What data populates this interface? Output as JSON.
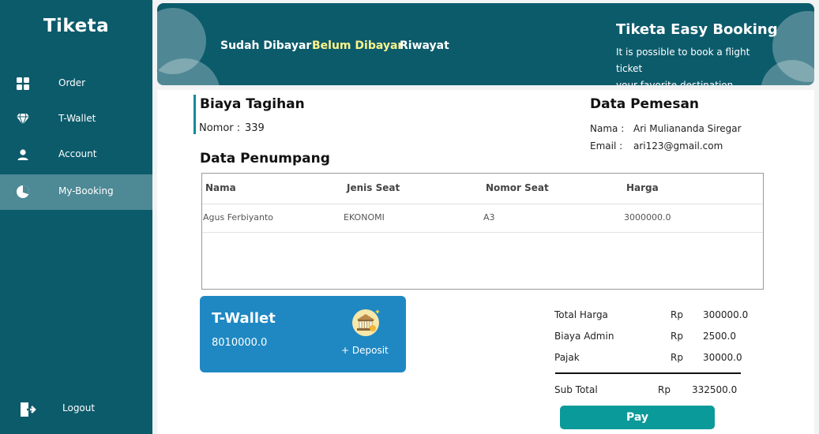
{
  "sidebar": {
    "brand": "Tiketa",
    "items": [
      {
        "label": "Order",
        "icon": "grid-icon"
      },
      {
        "label": "T-Wallet",
        "icon": "diamond-icon"
      },
      {
        "label": "Account",
        "icon": "user-icon"
      },
      {
        "label": "My-Booking",
        "icon": "pie-chart-icon",
        "active": true
      }
    ],
    "logout": {
      "label": "Logout",
      "icon": "logout-icon"
    }
  },
  "header": {
    "tabs": [
      {
        "label": "Sudah Dibayar"
      },
      {
        "label": "Belum Dibayar",
        "active": true
      },
      {
        "label": "Riwayat"
      }
    ],
    "title": "Tiketa Easy Booking",
    "subtitle_line1": "It is possible to book a flight ticket",
    "subtitle_line2": "your favorite destination"
  },
  "bill": {
    "title": "Biaya Tagihan",
    "number_label": "Nomor :",
    "number_value": "339"
  },
  "order": {
    "title": "Data Pemesan",
    "name_label": "Nama :",
    "name_value": "Ari Muliananda Siregar",
    "email_label": "Email :",
    "email_value": "ari123@gmail.com"
  },
  "passengers": {
    "title": "Data Penumpang",
    "columns": [
      "Nama",
      "Jenis Seat",
      "Nomor Seat",
      "Harga"
    ],
    "rows": [
      [
        "Agus Ferbiyanto",
        "EKONOMI",
        "A3",
        "3000000.0"
      ]
    ]
  },
  "wallet": {
    "title": "T-Wallet",
    "balance": "8010000.0",
    "deposit_label": "+ Deposit"
  },
  "summary": {
    "total_label": "Total Harga",
    "total_cur": "Rp",
    "total_value": "300000.0",
    "admin_label": "Biaya Admin",
    "admin_cur": "Rp",
    "admin_value": "2500.0",
    "tax_label": "Pajak",
    "tax_cur": "Rp",
    "tax_value": "30000.0",
    "subtotal_label": "Sub Total",
    "subtotal_cur": "Rp",
    "subtotal_value": "332500.0"
  },
  "pay_label": "Pay",
  "colors": {
    "sidebar": "#0c5b6b",
    "active_nav": "#4e8996",
    "active_tab": "#fdf38a",
    "wallet": "#1f88c2",
    "pay_button": "#0a9a99"
  }
}
